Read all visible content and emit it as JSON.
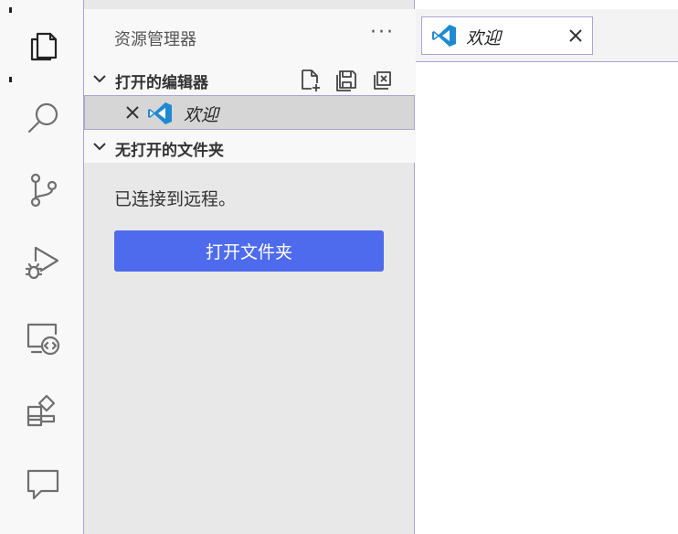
{
  "activity_bar": {
    "items": [
      {
        "name": "explorer-icon"
      },
      {
        "name": "search-icon"
      },
      {
        "name": "source-control-icon"
      },
      {
        "name": "run-debug-icon"
      },
      {
        "name": "remote-explorer-icon"
      },
      {
        "name": "extensions-icon"
      },
      {
        "name": "comments-icon"
      }
    ]
  },
  "sidebar": {
    "title": "资源管理器",
    "more": "···",
    "open_editors": {
      "label": "打开的编辑器",
      "items": [
        {
          "name": "欢迎"
        }
      ]
    },
    "no_folder": {
      "label": "无打开的文件夹",
      "message": "已连接到远程。",
      "button": "打开文件夹"
    }
  },
  "editor": {
    "tabs": [
      {
        "name": "欢迎"
      }
    ]
  },
  "colors": {
    "accent_button": "#4f6bed",
    "focus_border": "#a9a4d4",
    "vscode_blue": "#1f8ad2"
  }
}
